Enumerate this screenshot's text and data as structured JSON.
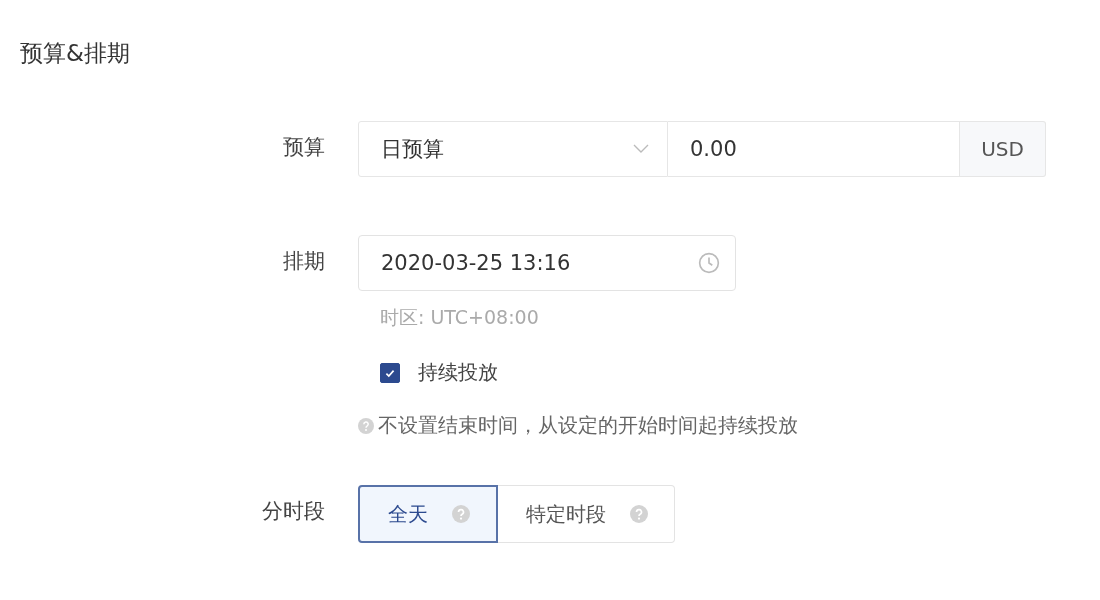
{
  "section_title": "预算&排期",
  "budget": {
    "label": "预算",
    "type_select": "日预算",
    "amount": "0.00",
    "currency": "USD"
  },
  "schedule": {
    "label": "排期",
    "start": "2020-03-25 13:16",
    "timezone": "时区: UTC+08:00",
    "continuous": {
      "label": "持续投放",
      "checked": true
    },
    "hint": "不设置结束时间，从设定的开始时间起持续投放"
  },
  "dayparting": {
    "label": "分时段",
    "options": [
      {
        "label": "全天",
        "selected": true
      },
      {
        "label": "特定时段",
        "selected": false
      }
    ]
  }
}
